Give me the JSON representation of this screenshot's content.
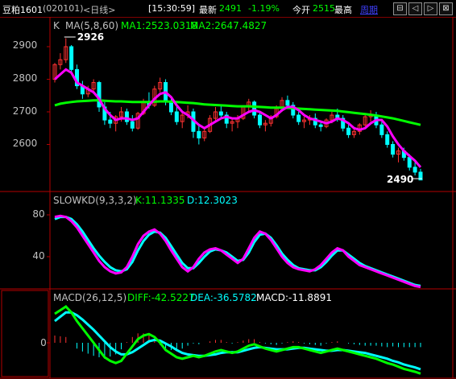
{
  "header": {
    "instrument": "豆粕1601",
    "code": "(020101)",
    "period": "<日线>",
    "time": "[15:30:59]",
    "latest_label": "最新",
    "latest_value": "2491",
    "change": "-1.19%",
    "open_label": "今开",
    "open_value": "2515",
    "high_label": "最高",
    "cycle_label": "周期",
    "buttons": [
      "⊟",
      "◁",
      "▷",
      "⊠"
    ]
  },
  "colors": {
    "up": "#ff3232",
    "down": "#00ffff",
    "ma5": "#ff00ff",
    "ma60": "#00ff00",
    "axis": "#b40000",
    "text": "#c0c0c0",
    "cyan": "#00e0e0",
    "signal": "#00c000"
  },
  "price_panel": {
    "title": "K",
    "ma_label": "MA(5,8,60)",
    "ma1_text": "MA1:2523.0318",
    "ma2_text": "MA2:2647.4827",
    "y_ticks": [
      "2900",
      "2800",
      "2700",
      "2600"
    ],
    "high_marker": "2926",
    "low_marker": "2490"
  },
  "kd_panel": {
    "title": "SLOWKD(9,3,3,2)",
    "k_text": "K:11.1335",
    "d_text": "D:12.3023",
    "y_ticks": [
      "80",
      "40"
    ]
  },
  "macd_panel": {
    "title": "MACD(26,12,5)",
    "diff_text": "DIFF:-42.5227",
    "dea_text": "DEA:-36.5782",
    "macd_text": "MACD:-11.8891",
    "y_ticks": [
      "0"
    ]
  },
  "chart_data": {
    "type": "candlestick",
    "candles": [
      [
        2800,
        2850,
        2790,
        2845
      ],
      [
        2845,
        2880,
        2830,
        2860
      ],
      [
        2860,
        2926,
        2850,
        2900
      ],
      [
        2900,
        2905,
        2820,
        2830
      ],
      [
        2830,
        2845,
        2770,
        2780
      ],
      [
        2780,
        2795,
        2740,
        2755
      ],
      [
        2755,
        2780,
        2745,
        2770
      ],
      [
        2770,
        2800,
        2755,
        2790
      ],
      [
        2790,
        2795,
        2700,
        2715
      ],
      [
        2715,
        2730,
        2660,
        2675
      ],
      [
        2675,
        2700,
        2650,
        2665
      ],
      [
        2665,
        2690,
        2640,
        2685
      ],
      [
        2685,
        2715,
        2670,
        2700
      ],
      [
        2700,
        2710,
        2660,
        2670
      ],
      [
        2670,
        2690,
        2640,
        2650
      ],
      [
        2650,
        2700,
        2645,
        2695
      ],
      [
        2695,
        2740,
        2690,
        2730
      ],
      [
        2730,
        2760,
        2710,
        2720
      ],
      [
        2720,
        2780,
        2715,
        2770
      ],
      [
        2770,
        2805,
        2760,
        2790
      ],
      [
        2790,
        2800,
        2720,
        2730
      ],
      [
        2730,
        2745,
        2690,
        2700
      ],
      [
        2700,
        2715,
        2660,
        2670
      ],
      [
        2670,
        2700,
        2650,
        2690
      ],
      [
        2690,
        2720,
        2680,
        2700
      ],
      [
        2700,
        2710,
        2620,
        2640
      ],
      [
        2640,
        2660,
        2600,
        2620
      ],
      [
        2620,
        2650,
        2610,
        2640
      ],
      [
        2640,
        2690,
        2635,
        2680
      ],
      [
        2680,
        2715,
        2670,
        2700
      ],
      [
        2700,
        2720,
        2680,
        2690
      ],
      [
        2690,
        2700,
        2650,
        2665
      ],
      [
        2665,
        2680,
        2640,
        2670
      ],
      [
        2670,
        2690,
        2650,
        2680
      ],
      [
        2680,
        2720,
        2675,
        2715
      ],
      [
        2715,
        2740,
        2700,
        2730
      ],
      [
        2730,
        2735,
        2680,
        2690
      ],
      [
        2690,
        2700,
        2650,
        2660
      ],
      [
        2660,
        2675,
        2640,
        2665
      ],
      [
        2665,
        2690,
        2655,
        2685
      ],
      [
        2685,
        2720,
        2680,
        2710
      ],
      [
        2710,
        2745,
        2700,
        2735
      ],
      [
        2735,
        2750,
        2710,
        2720
      ],
      [
        2720,
        2730,
        2680,
        2690
      ],
      [
        2690,
        2700,
        2660,
        2670
      ],
      [
        2670,
        2685,
        2650,
        2675
      ],
      [
        2675,
        2690,
        2660,
        2680
      ],
      [
        2680,
        2695,
        2650,
        2660
      ],
      [
        2660,
        2670,
        2640,
        2655
      ],
      [
        2655,
        2680,
        2650,
        2675
      ],
      [
        2675,
        2700,
        2665,
        2690
      ],
      [
        2690,
        2710,
        2670,
        2680
      ],
      [
        2680,
        2690,
        2640,
        2650
      ],
      [
        2650,
        2660,
        2620,
        2630
      ],
      [
        2630,
        2650,
        2620,
        2640
      ],
      [
        2640,
        2665,
        2630,
        2660
      ],
      [
        2660,
        2690,
        2655,
        2685
      ],
      [
        2685,
        2705,
        2670,
        2690
      ],
      [
        2690,
        2700,
        2650,
        2660
      ],
      [
        2660,
        2670,
        2620,
        2630
      ],
      [
        2630,
        2640,
        2590,
        2600
      ],
      [
        2600,
        2610,
        2560,
        2570
      ],
      [
        2570,
        2590,
        2545,
        2580
      ],
      [
        2580,
        2590,
        2550,
        2560
      ],
      [
        2560,
        2570,
        2520,
        2530
      ],
      [
        2530,
        2545,
        2505,
        2515
      ],
      [
        2515,
        2525,
        2490,
        2491
      ]
    ],
    "ma5": [
      2800,
      2815,
      2830,
      2820,
      2790,
      2780,
      2770,
      2760,
      2740,
      2710,
      2690,
      2675,
      2680,
      2680,
      2675,
      2680,
      2700,
      2720,
      2740,
      2755,
      2760,
      2745,
      2720,
      2700,
      2690,
      2675,
      2660,
      2650,
      2660,
      2670,
      2680,
      2685,
      2680,
      2680,
      2690,
      2700,
      2705,
      2700,
      2690,
      2680,
      2690,
      2705,
      2715,
      2715,
      2705,
      2690,
      2680,
      2675,
      2670,
      2665,
      2670,
      2680,
      2675,
      2665,
      2650,
      2645,
      2650,
      2665,
      2675,
      2675,
      2655,
      2625,
      2600,
      2580,
      2565,
      2550,
      2530
    ],
    "ma60": [
      2720,
      2725,
      2728,
      2730,
      2732,
      2733,
      2734,
      2735,
      2735,
      2734,
      2733,
      2732,
      2732,
      2731,
      2730,
      2730,
      2730,
      2730,
      2731,
      2732,
      2732,
      2731,
      2730,
      2729,
      2728,
      2727,
      2725,
      2723,
      2722,
      2721,
      2720,
      2719,
      2718,
      2717,
      2717,
      2717,
      2716,
      2715,
      2714,
      2713,
      2713,
      2713,
      2712,
      2711,
      2710,
      2709,
      2708,
      2707,
      2706,
      2705,
      2704,
      2703,
      2701,
      2699,
      2697,
      2695,
      2693,
      2691,
      2689,
      2686,
      2683,
      2680,
      2676,
      2672,
      2668,
      2664,
      2660
    ],
    "kd_k": [
      78,
      79,
      78,
      74,
      68,
      60,
      52,
      44,
      36,
      30,
      26,
      24,
      25,
      30,
      40,
      52,
      60,
      64,
      66,
      62,
      55,
      46,
      38,
      30,
      26,
      30,
      38,
      44,
      47,
      48,
      46,
      42,
      38,
      34,
      38,
      48,
      58,
      64,
      62,
      56,
      48,
      40,
      34,
      30,
      28,
      27,
      26,
      28,
      32,
      38,
      44,
      48,
      46,
      40,
      36,
      32,
      30,
      28,
      26,
      24,
      22,
      20,
      18,
      16,
      14,
      12,
      11
    ],
    "kd_d": [
      76,
      78,
      78,
      76,
      71,
      64,
      56,
      48,
      41,
      35,
      30,
      27,
      26,
      28,
      35,
      46,
      55,
      61,
      64,
      63,
      58,
      50,
      42,
      34,
      29,
      29,
      34,
      40,
      45,
      47,
      46,
      44,
      40,
      36,
      37,
      44,
      54,
      61,
      62,
      58,
      51,
      43,
      37,
      32,
      29,
      28,
      27,
      27,
      30,
      35,
      41,
      46,
      46,
      42,
      38,
      34,
      31,
      29,
      27,
      25,
      23,
      21,
      19,
      17,
      15,
      13,
      12
    ],
    "macd_diff": [
      40,
      45,
      50,
      42,
      30,
      20,
      10,
      0,
      -10,
      -20,
      -25,
      -28,
      -25,
      -15,
      -5,
      5,
      10,
      12,
      8,
      0,
      -10,
      -15,
      -20,
      -22,
      -20,
      -18,
      -20,
      -18,
      -15,
      -12,
      -10,
      -12,
      -14,
      -12,
      -8,
      -4,
      -2,
      -5,
      -8,
      -10,
      -12,
      -10,
      -8,
      -6,
      -6,
      -8,
      -10,
      -12,
      -14,
      -12,
      -10,
      -8,
      -10,
      -12,
      -14,
      -16,
      -18,
      -20,
      -22,
      -25,
      -28,
      -30,
      -33,
      -36,
      -38,
      -40,
      -42.5
    ],
    "macd_dea": [
      30,
      36,
      42,
      42,
      38,
      32,
      25,
      18,
      10,
      2,
      -6,
      -12,
      -16,
      -16,
      -13,
      -8,
      -3,
      2,
      4,
      3,
      -1,
      -5,
      -10,
      -14,
      -16,
      -17,
      -18,
      -18,
      -17,
      -16,
      -14,
      -13,
      -13,
      -13,
      -11,
      -9,
      -7,
      -6,
      -7,
      -8,
      -9,
      -9,
      -9,
      -8,
      -7,
      -7,
      -8,
      -9,
      -10,
      -11,
      -11,
      -10,
      -10,
      -11,
      -12,
      -13,
      -14,
      -16,
      -18,
      -20,
      -22,
      -25,
      -27,
      -30,
      -32,
      -34,
      -36.6
    ],
    "macd_hist": [
      10,
      9,
      8,
      0,
      -8,
      -12,
      -15,
      -18,
      -20,
      -22,
      -19,
      -16,
      -9,
      1,
      8,
      13,
      13,
      10,
      4,
      -3,
      -9,
      -10,
      -10,
      -8,
      -4,
      -1,
      -2,
      0,
      2,
      4,
      4,
      1,
      -1,
      1,
      3,
      5,
      5,
      1,
      -1,
      -2,
      -3,
      -1,
      1,
      2,
      1,
      -1,
      -2,
      -3,
      -4,
      -1,
      1,
      2,
      0,
      -1,
      -2,
      -3,
      -4,
      -4,
      -4,
      -5,
      -6,
      -5,
      -6,
      -6,
      -6,
      -6,
      -6
    ],
    "high_index": 2,
    "low_index": 66
  }
}
